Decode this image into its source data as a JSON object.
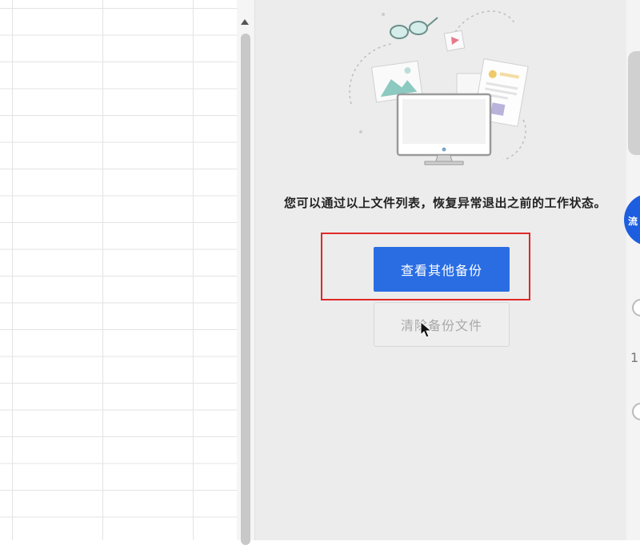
{
  "recovery_panel": {
    "message": "您可以通过以上文件列表，恢复异常退出之前的工作状态。",
    "view_backups_label": "查看其他备份",
    "clear_backups_label": "清除备份文件"
  },
  "side_widget": {
    "badge_text": "流",
    "fragment_digit": "1"
  },
  "colors": {
    "primary": "#2a6de3",
    "highlight": "#e02828",
    "panel_bg": "#ececec",
    "side_badge": "#1d5ee0"
  },
  "icons": [
    "scroll-up-icon",
    "glasses-icon",
    "play-icon",
    "picture-icon",
    "document-icon",
    "monitor-icon",
    "mouse-cursor-icon"
  ]
}
